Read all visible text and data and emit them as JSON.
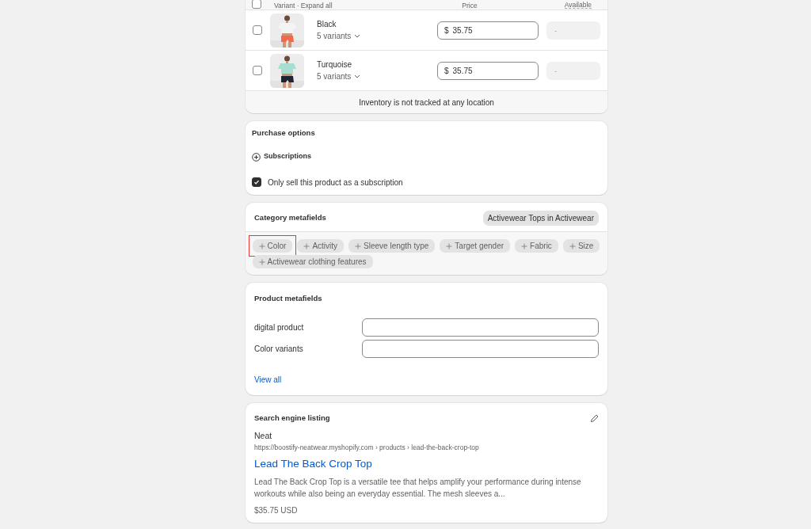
{
  "variants_table": {
    "columns": [
      "Variant · Expand all",
      "Price",
      "Available"
    ],
    "header_checked": false,
    "rows": [
      {
        "name": "Black",
        "variants": "5 variants",
        "currency": "$",
        "price": "35.75",
        "available": "-",
        "checked": false,
        "kind": "picture"
      },
      {
        "name": "Turquoise",
        "variants": "5 variants",
        "currency": "$",
        "price": "35.75",
        "available": "-",
        "checked": false,
        "kind": "picture"
      }
    ],
    "footer": "Inventory is not tracked at any location"
  },
  "purchase_options": {
    "title": "Purchase options",
    "subscriptions": "Subscriptions",
    "only_subscription": {
      "label": "Only sell this product as a subscription",
      "checked": true
    }
  },
  "category_metafields": {
    "title": "Category metafields",
    "category": "Activewear Tops in Activewear",
    "chips": [
      {
        "label": "Color",
        "highlighted": true
      },
      {
        "label": "Activity",
        "highlighted": false
      },
      {
        "label": "Sleeve length type",
        "highlighted": false
      },
      {
        "label": "Target gender",
        "highlighted": false
      },
      {
        "label": "Fabric",
        "highlighted": false
      },
      {
        "label": "Size",
        "highlighted": false
      },
      {
        "label": "Activewear clothing features",
        "highlighted": false
      }
    ]
  },
  "product_metafields": {
    "title": "Product metafields",
    "fields": [
      {
        "label": "digital product"
      },
      {
        "label": "Color variants"
      }
    ],
    "view_all": "View all"
  },
  "search_engine_listing": {
    "title": "Search engine listing",
    "site": "Neat",
    "url": "https://boostify-neatwear.myshopify.com › products › lead-the-back-crop-top",
    "page_title": "Lead The Back Crop Top",
    "description": "Lead The Back Crop Top is a versatile tee that helps amplify your performance during intense workouts while also being an everyday essential. The mesh sleeves a...",
    "price": "$35.75 USD"
  }
}
